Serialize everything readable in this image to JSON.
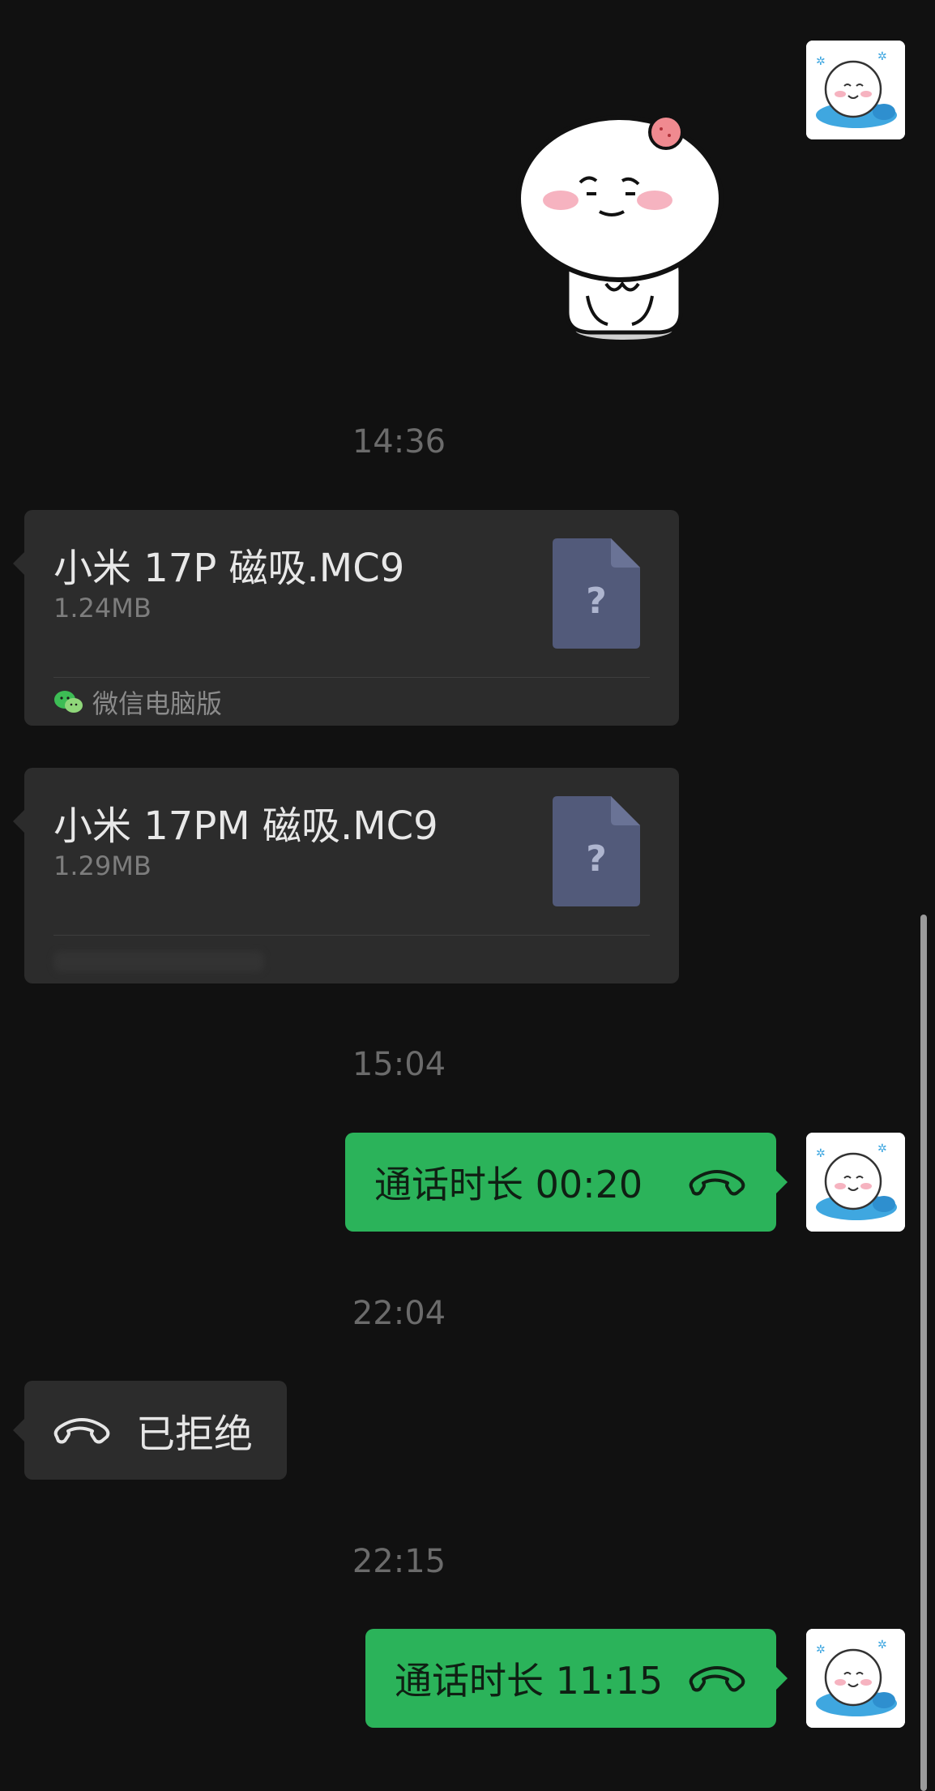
{
  "chat": {
    "messages": {
      "sticker": {
        "icon": "sticker-image"
      },
      "ts1": "14:36",
      "file1": {
        "name": "小米 17P 磁吸.MC9",
        "size": "1.24MB",
        "source": "微信电脑版"
      },
      "file2": {
        "name": "小米 17PM 磁吸.MC9",
        "size": "1.29MB"
      },
      "ts2": "15:04",
      "call1": "通话时长 00:20",
      "ts3": "22:04",
      "call_rejected": "已拒绝",
      "ts4": "22:15",
      "call2": "通话时长 11:15"
    }
  },
  "colors": {
    "background": "#111111",
    "sent_bubble": "#2bb35a",
    "received_bubble": "#2c2c2c",
    "timestamp": "#6b6b6b",
    "file_icon": "#525a7a"
  }
}
